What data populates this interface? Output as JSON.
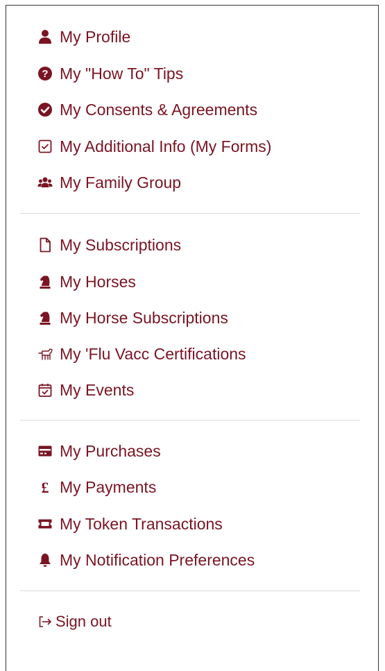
{
  "menu": {
    "accent_color": "#7a1422",
    "group1": [
      {
        "label": "My Profile",
        "icon": "user-icon"
      },
      {
        "label": "My \"How To\" Tips",
        "icon": "question-circle-icon"
      },
      {
        "label": "My Consents & Agreements",
        "icon": "check-circle-icon"
      },
      {
        "label": "My Additional Info (My Forms)",
        "icon": "checkbox-icon"
      },
      {
        "label": "My Family Group",
        "icon": "users-icon"
      }
    ],
    "group2": [
      {
        "label": "My Subscriptions",
        "icon": "file-icon"
      },
      {
        "label": "My Horses",
        "icon": "horse-chess-icon"
      },
      {
        "label": "My Horse Subscriptions",
        "icon": "horse-chess-icon"
      },
      {
        "label": "My 'Flu Vacc Certifications",
        "icon": "horse-outline-icon"
      },
      {
        "label": "My Events",
        "icon": "calendar-check-icon"
      }
    ],
    "group3": [
      {
        "label": "My Purchases",
        "icon": "credit-card-icon"
      },
      {
        "label": "My Payments",
        "icon": "pound-icon"
      },
      {
        "label": "My Token Transactions",
        "icon": "ticket-icon"
      },
      {
        "label": "My Notification Preferences",
        "icon": "bell-icon"
      }
    ],
    "sign_out": {
      "label": "Sign out",
      "icon": "sign-out-icon"
    }
  }
}
